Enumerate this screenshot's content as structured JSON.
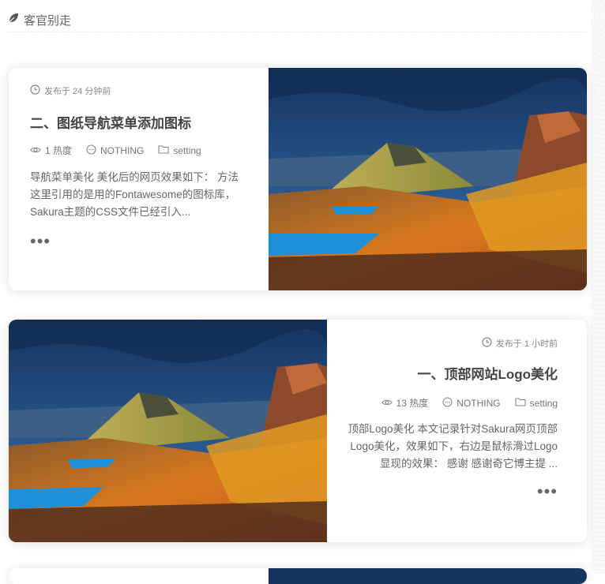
{
  "section": {
    "title": "客官别走",
    "icon": "leaf-icon"
  },
  "posts": [
    {
      "date": "发布于 24 分钟前",
      "title": "二、图纸导航菜单添加图标",
      "views": "1 热度",
      "comments": "NOTHING",
      "category": "setting",
      "excerpt": "导航菜单美化 美化后的网页效果如下： 方法 这里引用的是用的Fontawesome的图标库，Sakura主题的CSS文件已经引入...",
      "more": "•••"
    },
    {
      "date": "发布于 1 小时前",
      "title": "一、顶部网站Logo美化",
      "views": "13 热度",
      "comments": "NOTHING",
      "category": "setting",
      "excerpt": "顶部Logo美化 本文记录针对Sakura网页顶部Logo美化，效果如下，右边是鼠标滑过Logo显现的效果： 感谢 感谢奇它博主提 ...",
      "more": "•••"
    }
  ],
  "colors": {
    "sky": "#1f4f8f",
    "mountain": "#d2731f",
    "lake": "#1f90d8"
  }
}
